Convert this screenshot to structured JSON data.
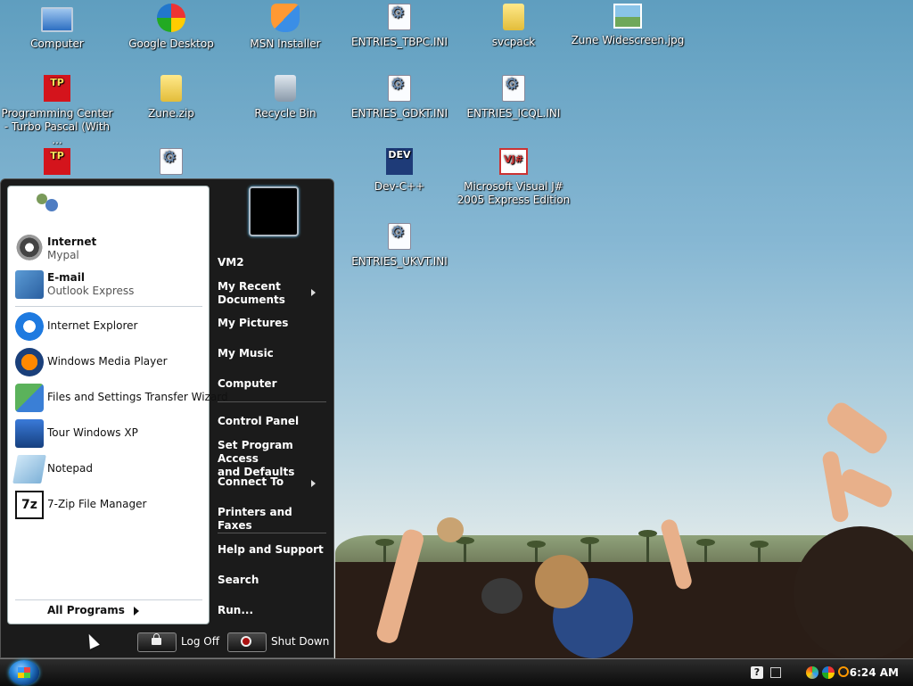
{
  "desktop": {
    "icons": [
      {
        "label": "Computer",
        "icon": "computer-icon"
      },
      {
        "label": "Google Desktop",
        "icon": "google-desktop-icon"
      },
      {
        "label": "MSN Installer",
        "icon": "msn-icon"
      },
      {
        "label": "ENTRIES_TBPC.INI",
        "icon": "ini-file-icon"
      },
      {
        "label": "svcpack",
        "icon": "folder-icon"
      },
      {
        "label": "Zune Widescreen.jpg",
        "icon": "image-file-icon"
      },
      {
        "label": "Programming Center - Turbo Pascal (With ...",
        "icon": "turbo-pascal-icon"
      },
      {
        "label": "Zune.zip",
        "icon": "zip-folder-icon"
      },
      {
        "label": "Recycle Bin",
        "icon": "recycle-bin-icon"
      },
      {
        "label": "ENTRIES_GDKT.INI",
        "icon": "ini-file-icon"
      },
      {
        "label": "ENTRIES_ICQL.INI",
        "icon": "ini-file-icon"
      },
      {
        "label": "Dev-C++",
        "icon": "dev-cpp-icon"
      },
      {
        "label": "Microsoft Visual J# 2005 Express Edition",
        "icon": "visual-jsharp-icon"
      },
      {
        "label": "ENTRIES_UKVT.INI",
        "icon": "ini-file-icon"
      }
    ],
    "partial_icons": [
      "turbo-pascal-icon",
      "ini-file-icon"
    ]
  },
  "start_menu": {
    "pinned": [
      {
        "title": "Internet",
        "subtitle": "Mypal",
        "icon": "mypal-raccoon-icon"
      },
      {
        "title": "E-mail",
        "subtitle": "Outlook Express",
        "icon": "outlook-express-icon"
      }
    ],
    "programs": [
      {
        "label": "Internet Explorer",
        "icon": "internet-explorer-icon"
      },
      {
        "label": "Windows Media Player",
        "icon": "windows-media-player-icon"
      },
      {
        "label": "Files and Settings Transfer Wizard",
        "icon": "transfer-wizard-icon"
      },
      {
        "label": "Tour Windows XP",
        "icon": "tour-windows-icon"
      },
      {
        "label": "Notepad",
        "icon": "notepad-icon"
      },
      {
        "label": "7-Zip File Manager",
        "icon": "7zip-icon"
      }
    ],
    "all_programs": "All Programs",
    "right": [
      {
        "label": "VM2"
      },
      {
        "label": "My Recent\nDocuments",
        "arrow": true
      },
      {
        "label": "My Pictures"
      },
      {
        "label": "My Music"
      },
      {
        "label": "Computer"
      },
      {
        "label": "Control Panel"
      },
      {
        "label": "Set Program Access\nand Defaults"
      },
      {
        "label": "Connect To",
        "arrow": true
      },
      {
        "label": "Printers and Faxes"
      },
      {
        "label": "Help and Support"
      },
      {
        "label": "Search"
      },
      {
        "label": "Run..."
      }
    ],
    "log_off": "Log Off",
    "shut_down": "Shut Down"
  },
  "taskbar": {
    "clock": "6:24 AM",
    "tray_icons": [
      "help-icon",
      "network-icon",
      "google-desktop-tray-icon",
      "search-tray-icon"
    ]
  },
  "colors": {
    "start_menu_bg": "#1b1b1b",
    "taskbar_bg": "#0b0b0b",
    "accent": "#2e8de0"
  }
}
